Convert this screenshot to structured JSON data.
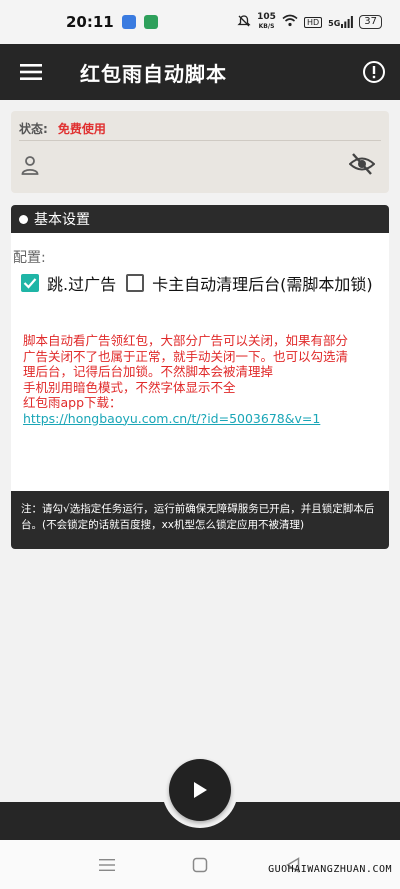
{
  "statusbar": {
    "time": "20:11",
    "net_speed": "105",
    "net_unit": "KB/S",
    "hd_label": "HD",
    "signal_label": "5G",
    "battery": "37"
  },
  "toolbar": {
    "title": "红包雨自动脚本",
    "menu_icon": "menu-icon",
    "info_icon": "info-icon"
  },
  "status": {
    "label": "状态:",
    "value": "免费使用",
    "password_value": "",
    "password_placeholder": ""
  },
  "settings": {
    "header": "基本设置",
    "config_label": "配置:",
    "options": [
      {
        "label": "跳.过广告",
        "checked": true
      },
      {
        "label": "卡主自动清理后台(需脚本加锁)",
        "checked": false
      }
    ],
    "description_lines": [
      "脚本自动看广告领红包，大部分广告可以关闭，如果有部分",
      "广告关闭不了也属于正常，就手动关闭一下。也可以勾选清",
      "理后台，记得后台加锁。不然脚本会被清理掉",
      "手机别用暗色模式，不然字体显示不全",
      "红包雨app下载："
    ],
    "link": "https://hongbaoyu.com.cn/t/?id=5003678&v=1"
  },
  "note": {
    "text": "注：请勾√选指定任务运行，运行前确保无障碍服务已开启，并且锁定脚本后台。(不会锁定的话就百度搜，xx机型怎么锁定应用不被清理)"
  },
  "fab": {
    "icon": "play-icon"
  },
  "navbar": {
    "items": [
      "menu-nav-icon",
      "home-nav-icon",
      "back-nav-icon"
    ]
  },
  "watermark": "GUOHAIWANGZHUAN.COM",
  "colors": {
    "toolbar": "#262626",
    "status_red": "#e03030",
    "checkbox_accent": "#1fb5a6",
    "link": "#1aa6b7"
  }
}
